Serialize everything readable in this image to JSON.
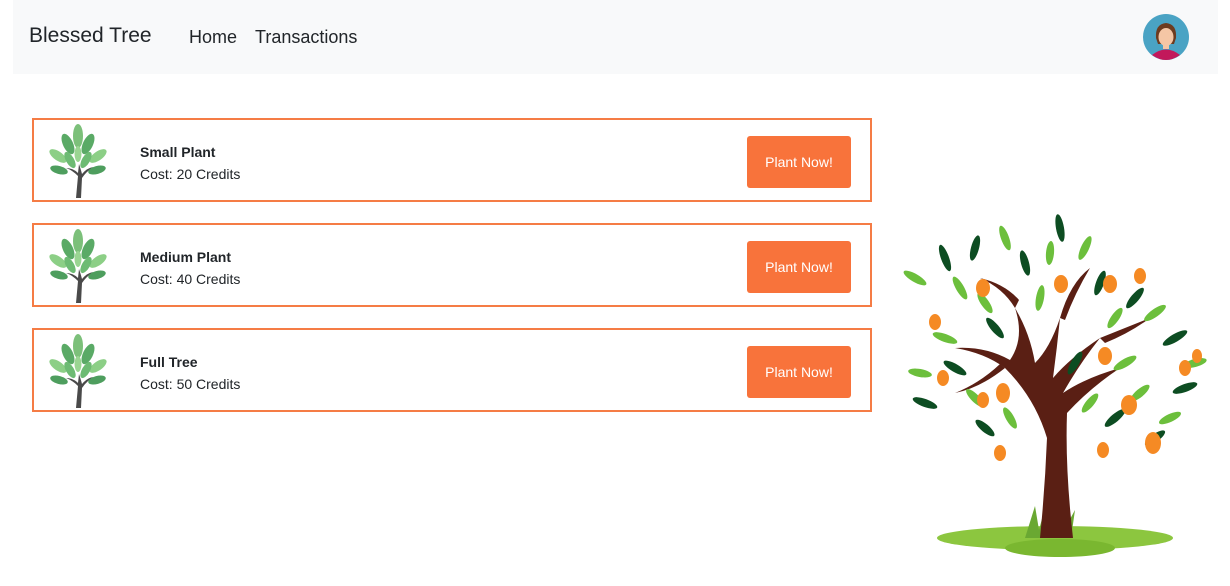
{
  "nav": {
    "brand": "Blessed Tree",
    "links": [
      {
        "label": "Home"
      },
      {
        "label": "Transactions"
      }
    ],
    "avatar_icon": "user-avatar-icon"
  },
  "plans": [
    {
      "name": "Small Plant",
      "cost": "Cost: 20 Credits",
      "button": "Plant Now!",
      "icon": "sapling-icon"
    },
    {
      "name": "Medium Plant",
      "cost": "Cost: 40 Credits",
      "button": "Plant Now!",
      "icon": "sapling-icon"
    },
    {
      "name": "Full Tree",
      "cost": "Cost: 50 Credits",
      "button": "Plant Now!",
      "icon": "sapling-icon"
    }
  ],
  "illustration": "mango-tree-illustration",
  "colors": {
    "accent": "#f8733b",
    "card_border": "#f57c45",
    "navbar_bg": "#f8f9fa",
    "leaf_green": "#5cb85c"
  }
}
